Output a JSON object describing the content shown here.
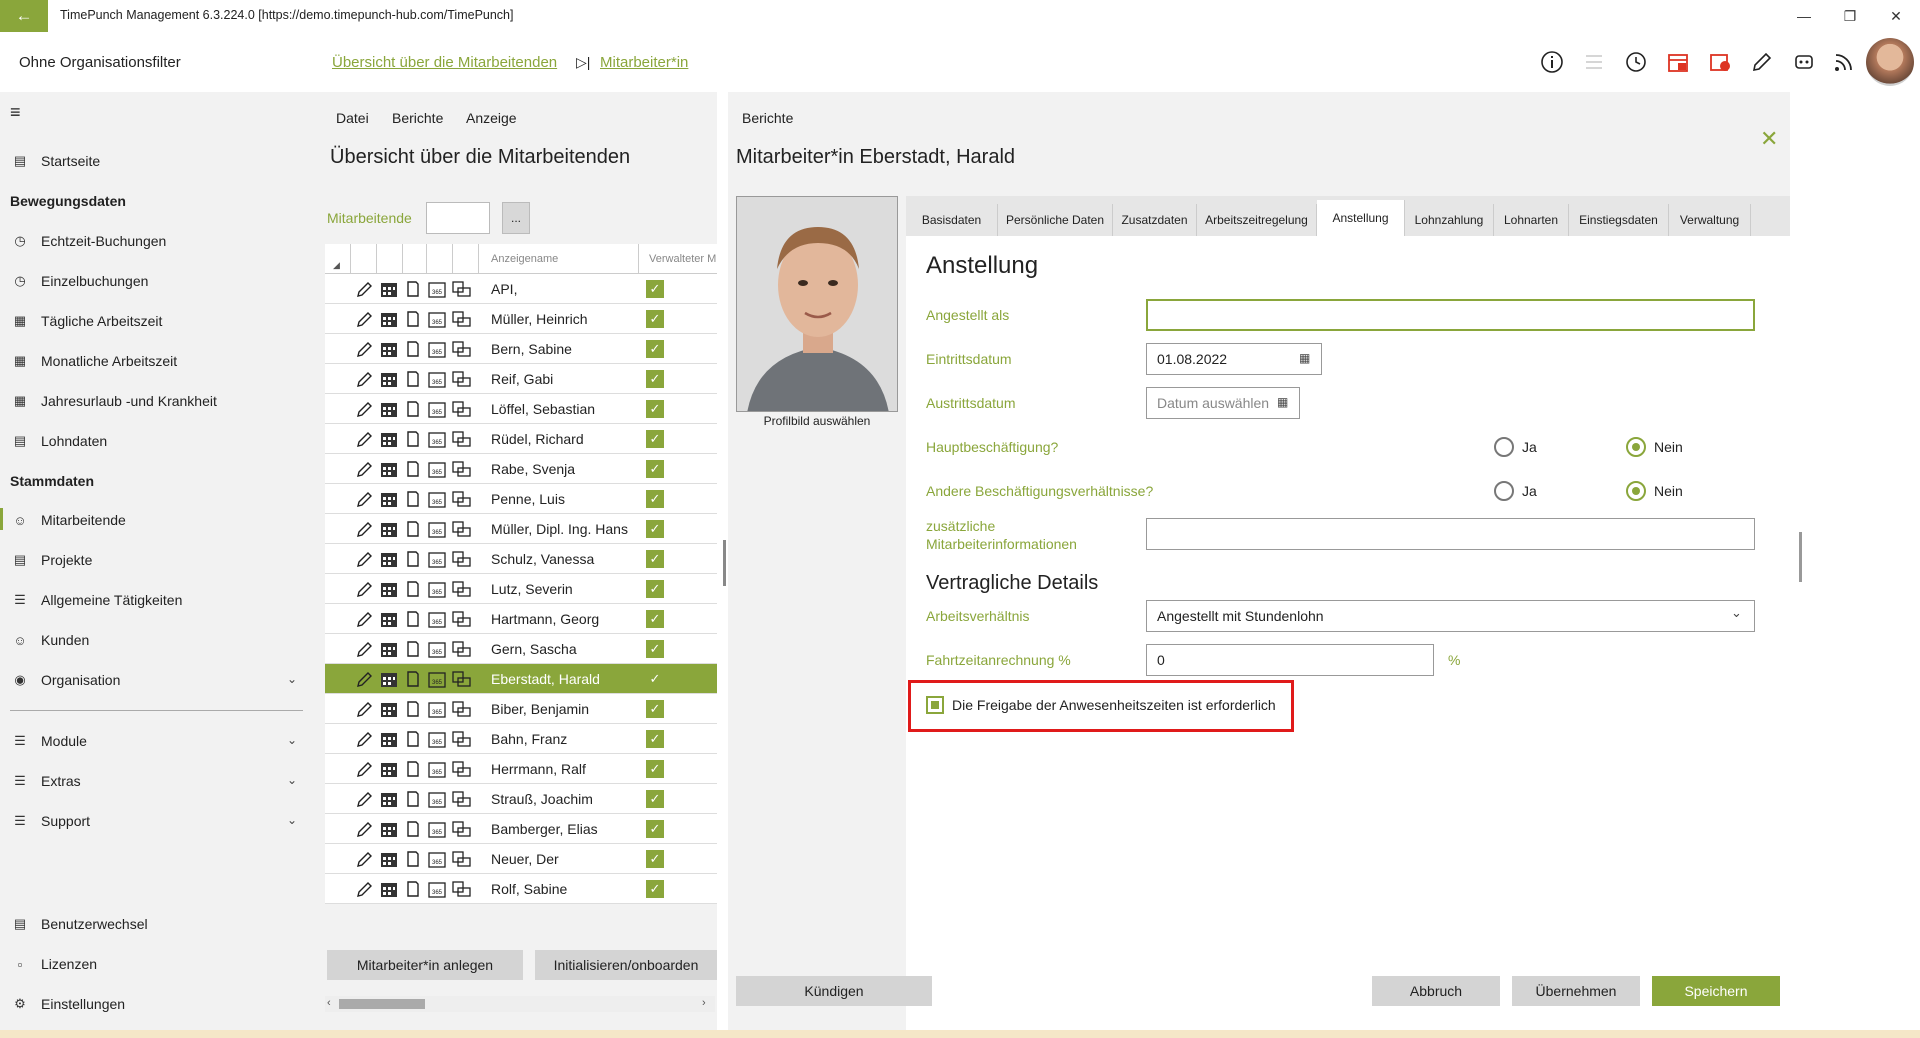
{
  "titlebar": {
    "title": "TimePunch Management 6.3.224.0 [https://demo.timepunch-hub.com/TimePunch]"
  },
  "topbar": {
    "org_filter": "Ohne Organisationsfilter",
    "link_overview": "Übersicht über die Mitarbeitenden",
    "link_employee": "Mitarbeiter*in"
  },
  "sidebar": {
    "home": "Startseite",
    "section_movement": "Bewegungsdaten",
    "realtime": "Echtzeit-Buchungen",
    "single": "Einzelbuchungen",
    "daily": "Tägliche Arbeitszeit",
    "monthly": "Monatliche Arbeitszeit",
    "vacation": "Jahresurlaub -und Krankheit",
    "payroll": "Lohndaten",
    "section_master": "Stammdaten",
    "employees": "Mitarbeitende",
    "projects": "Projekte",
    "activities": "Allgemeine Tätigkeiten",
    "customers": "Kunden",
    "organisation": "Organisation",
    "modules": "Module",
    "extras": "Extras",
    "support": "Support",
    "user_switch": "Benutzerwechsel",
    "licenses": "Lizenzen",
    "settings": "Einstellungen"
  },
  "list": {
    "menu": [
      "Datei",
      "Berichte",
      "Anzeige"
    ],
    "title": "Übersicht über die Mitarbeitenden",
    "filter_label": "Mitarbeitende",
    "filter_button": "...",
    "col_name": "Anzeigename",
    "col_managed": "Verwalteter M",
    "rows": [
      "API,",
      "Müller, Heinrich",
      "Bern, Sabine",
      "Reif, Gabi",
      "Löffel, Sebastian",
      "Rüdel, Richard",
      "Rabe, Svenja",
      "Penne, Luis",
      "Müller, Dipl. Ing. Hans",
      "Schulz, Vanessa",
      "Lutz, Severin",
      "Hartmann, Georg",
      "Gern, Sascha",
      "Eberstadt, Harald",
      "Biber, Benjamin",
      "Bahn, Franz",
      "Herrmann, Ralf",
      "Strauß, Joachim",
      "Bamberger, Elias",
      "Neuer, Der",
      "Rolf, Sabine"
    ],
    "selected_index": 13,
    "btn_create": "Mitarbeiter*in anlegen",
    "btn_onboard": "Initialisieren/onboarden"
  },
  "detail": {
    "header": "Berichte",
    "title": "Mitarbeiter*in Eberstadt, Harald",
    "photo_caption": "Profilbild auswählen",
    "tabs": [
      "Basisdaten",
      "Persönliche Daten",
      "Zusatzdaten",
      "Arbeitszeitregelung",
      "Anstellung",
      "Lohnzahlung",
      "Lohnarten",
      "Einstiegsdaten",
      "Verwaltung"
    ],
    "active_tab": "Anstellung",
    "section_title": "Anstellung",
    "employed_as_label": "Angestellt als",
    "employed_as_value": "",
    "start_label": "Eintrittsdatum",
    "start_value": "01.08.2022",
    "end_label": "Austrittsdatum",
    "end_placeholder": "Datum auswählen",
    "main_job_label": "Hauptbeschäftigung?",
    "other_jobs_label": "Andere Beschäftigungsverhältnisse?",
    "yes": "Ja",
    "no": "Nein",
    "extra_info_label_1": "zusätzliche",
    "extra_info_label_2": "Mitarbeiterinformationen",
    "extra_info_value": "",
    "contract_title": "Vertragliche Details",
    "relation_label": "Arbeitsverhältnis",
    "relation_value": "Angestellt mit Stundenlohn",
    "travel_label": "Fahrtzeitanrechnung %",
    "travel_value": "0",
    "percent": "%",
    "approval_label": "Die Freigabe der Anwesenheitszeiten ist erforderlich",
    "btn_terminate": "Kündigen",
    "btn_cancel": "Abbruch",
    "btn_apply": "Übernehmen",
    "btn_save": "Speichern"
  },
  "colors": {
    "accent": "#8aa63b",
    "highlight": "#e01a1a"
  }
}
